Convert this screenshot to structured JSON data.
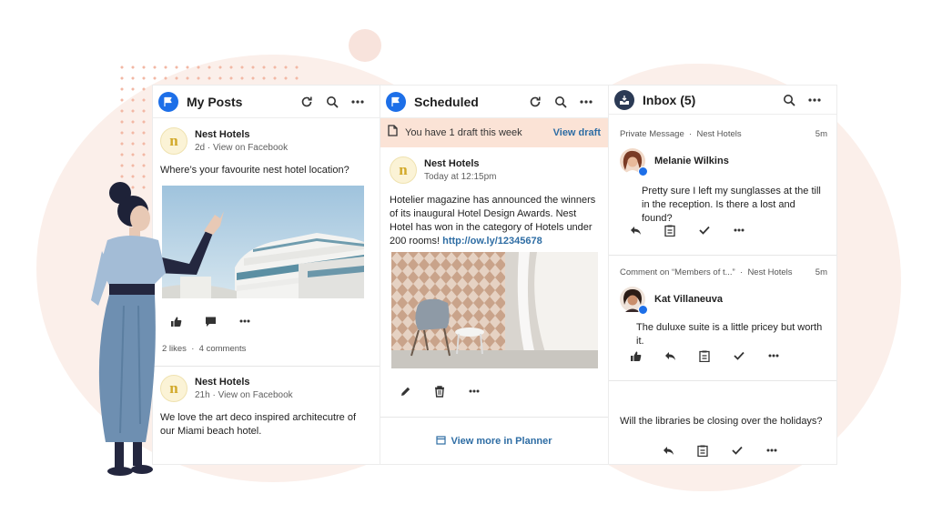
{
  "columns": {
    "my_posts": {
      "title": "My Posts",
      "posts": [
        {
          "author": "Nest Hotels",
          "age": "2d",
          "via": "View on Facebook",
          "text": "Where’s your favourite nest hotel location?",
          "likes": "2 likes",
          "comments": "4 comments"
        },
        {
          "author": "Nest Hotels",
          "age": "21h",
          "via": "View on Facebook",
          "text": "We love the art deco inspired architecutre of our Miami beach hotel."
        }
      ]
    },
    "scheduled": {
      "title": "Scheduled",
      "draft_notice": "You have 1 draft this week",
      "draft_link": "View draft",
      "post": {
        "author": "Nest Hotels",
        "time": "Today at 12:15pm",
        "text": "Hotelier magazine has announced the winners of its inaugural Hotel Design Awards. Nest Hotel has won in the category of Hotels under 200 rooms!",
        "link": "http://ow.ly/12345678"
      },
      "view_more": "View more in Planner"
    },
    "inbox": {
      "title": "Inbox (5)",
      "messages": [
        {
          "type": "Private Message",
          "account": "Nest Hotels",
          "time": "5m",
          "name": "Melanie Wilkins",
          "text": "Pretty sure I left my sunglasses at the till in the reception. Is there a lost and found?"
        },
        {
          "type": "Comment on “Members of t...”",
          "account": "Nest Hotels",
          "time": "5m",
          "name": "Kat Villaneuva",
          "text": "The duluxe suite is a little pricey but worth it."
        },
        {
          "text": "Will the libraries be closing over the holidays?"
        }
      ]
    }
  },
  "colors": {
    "accent_blue": "#1d6fe8",
    "link": "#2e6da4",
    "draft_bg": "#fbe3d6",
    "background_blob": "#fbefea"
  },
  "icons": {
    "my_posts": "flag-icon",
    "scheduled": "flag-icon",
    "inbox": "inbox-tray-icon",
    "header_actions": [
      "refresh-icon",
      "search-icon",
      "more-icon"
    ],
    "post_actions": [
      "like-icon",
      "comment-icon",
      "more-icon"
    ],
    "scheduled_actions": [
      "edit-icon",
      "trash-icon",
      "more-icon"
    ],
    "inbox_actions": [
      "reply-icon",
      "assign-icon",
      "check-icon",
      "more-icon"
    ]
  }
}
